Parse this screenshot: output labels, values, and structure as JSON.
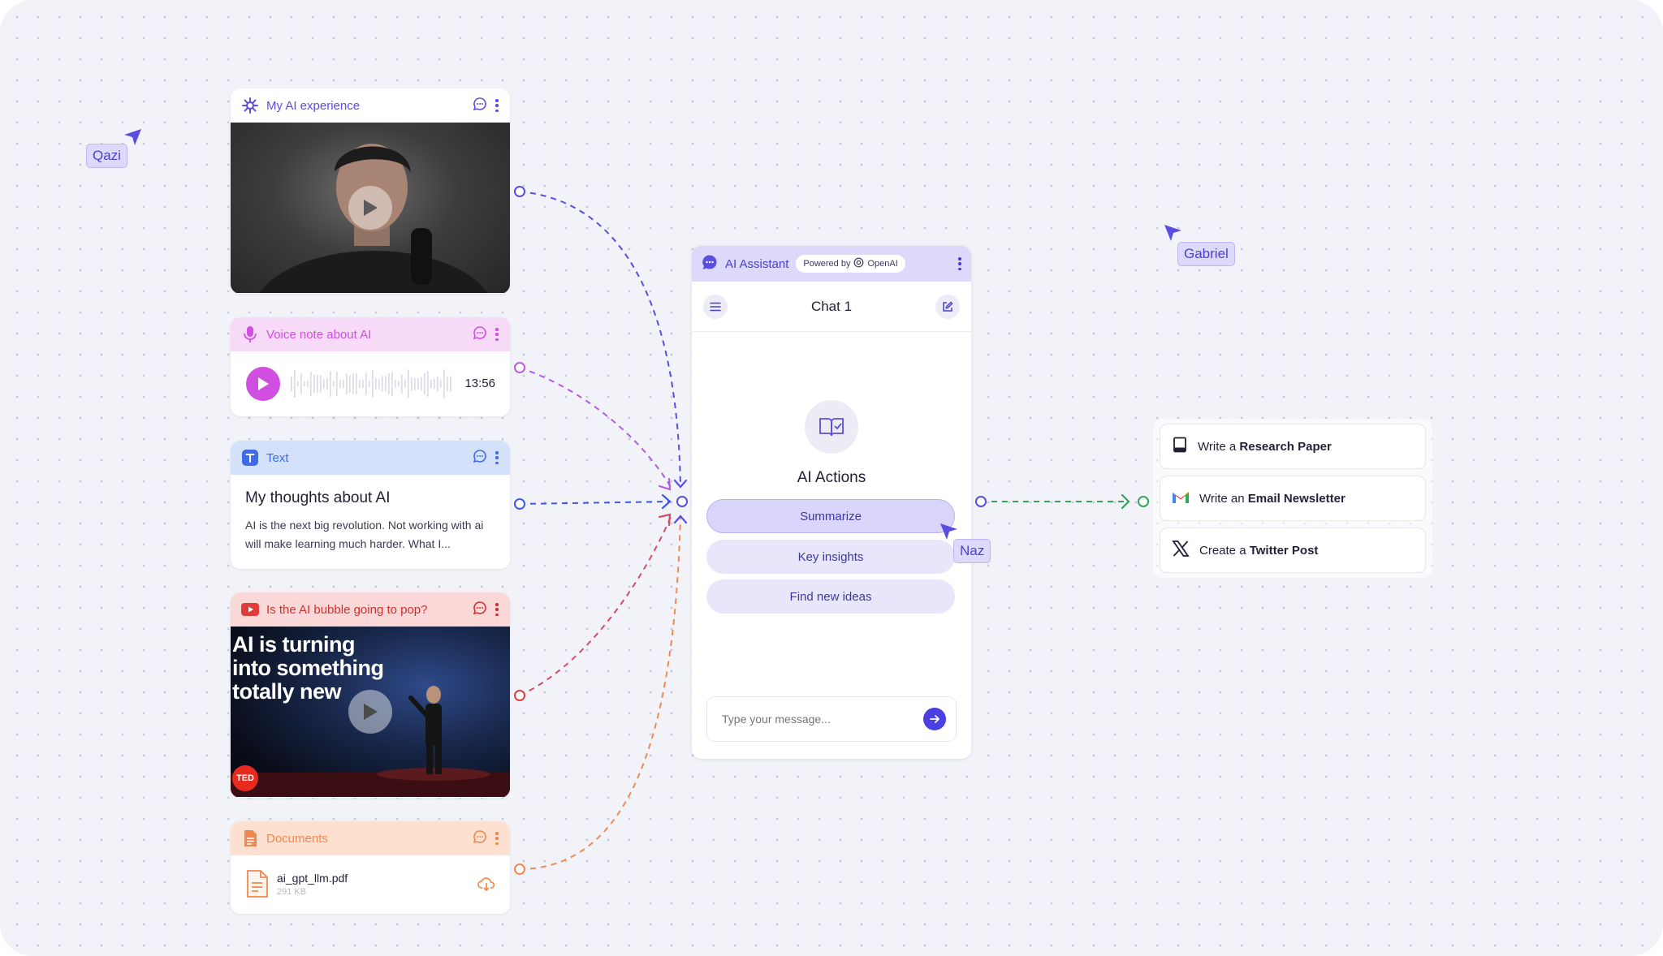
{
  "cards": {
    "video1": {
      "title": "My AI experience"
    },
    "voice": {
      "title": "Voice note about AI",
      "duration": "13:56"
    },
    "text": {
      "title": "Text",
      "heading": "My thoughts about AI",
      "body": "AI is the next big revolution. Not working with ai will make learning much harder. What I..."
    },
    "youtube": {
      "title": "Is the AI bubble going to pop?",
      "overlay_line1": "AI is turning",
      "overlay_line2": "into something",
      "overlay_line3": "totally new",
      "badge": "TED"
    },
    "documents": {
      "title": "Documents",
      "file_name": "ai_gpt_llm.pdf",
      "file_size": "291 KB"
    }
  },
  "assistant": {
    "title": "AI Assistant",
    "powered_prefix": "Powered by",
    "powered_brand": "OpenAI",
    "chat_title": "Chat 1",
    "actions_title": "AI Actions",
    "actions": [
      "Summarize",
      "Key insights",
      "Find new ideas"
    ],
    "input_placeholder": "Type your message..."
  },
  "outputs": [
    {
      "prefix": "Write a ",
      "bold": "Research Paper",
      "icon": "notebook-icon"
    },
    {
      "prefix": "Write an ",
      "bold": "Email Newsletter",
      "icon": "gmail-icon"
    },
    {
      "prefix": "Create a ",
      "bold": "Twitter Post",
      "icon": "x-logo-icon"
    }
  ],
  "cursors": {
    "qazi": {
      "name": "Qazi"
    },
    "gabriel": {
      "name": "Gabriel"
    },
    "naz": {
      "name": "Naz"
    }
  },
  "colors": {
    "purple": "#5b4de0",
    "voice": "#d04ee0",
    "text_blue": "#3f6ae8",
    "youtube_red": "#e03c3c",
    "documents_orange": "#f0884e",
    "green": "#35a55a"
  }
}
